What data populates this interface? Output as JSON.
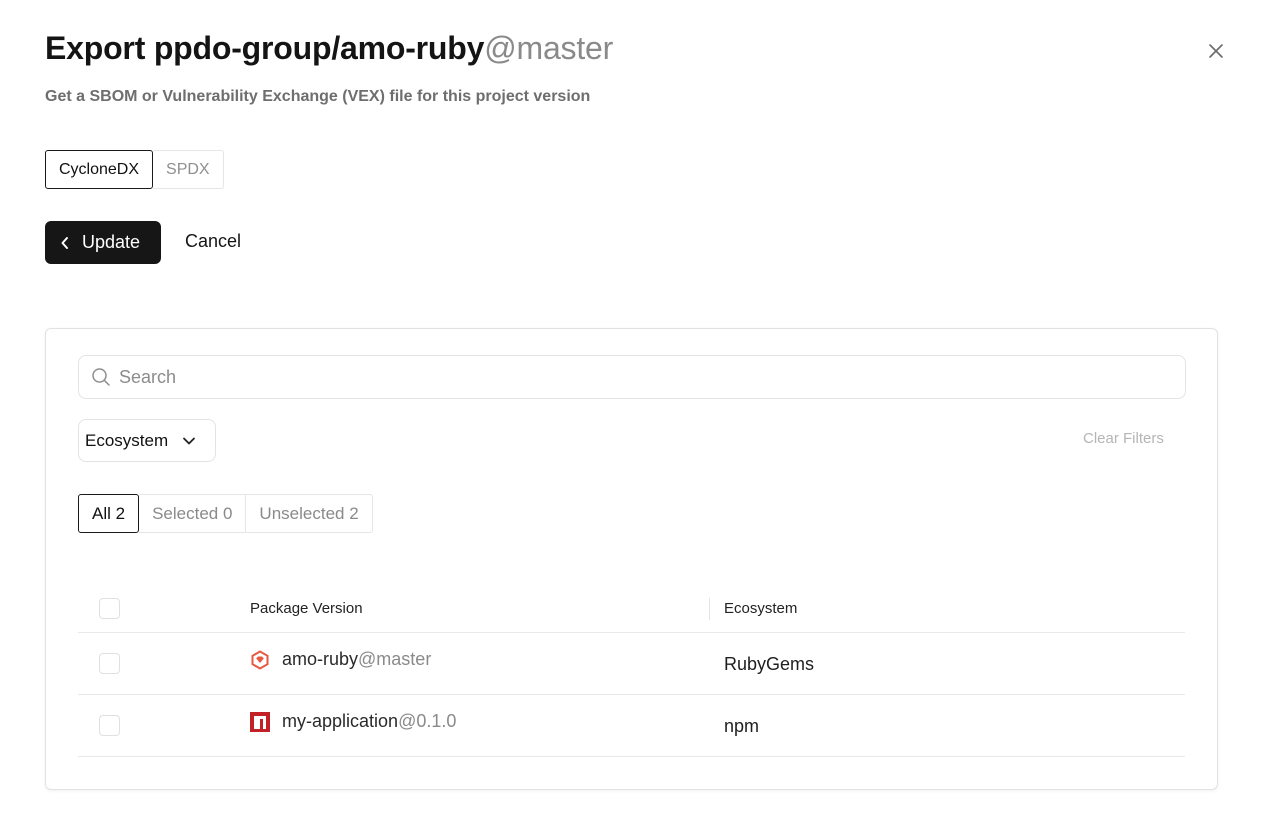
{
  "header": {
    "title_bold": "Export ppdo-group/amo-ruby",
    "title_muted": "@master",
    "subtitle": "Get a SBOM or Vulnerability Exchange (VEX) file for this project version"
  },
  "format": {
    "options": [
      "CycloneDX",
      "SPDX"
    ],
    "selected": "CycloneDX"
  },
  "actions": {
    "update_label": "Update",
    "cancel_label": "Cancel"
  },
  "filters": {
    "search_placeholder": "Search",
    "ecosystem_label": "Ecosystem",
    "clear_label": "Clear Filters"
  },
  "selection_tabs": [
    {
      "label": "All 2",
      "active": true
    },
    {
      "label": "Selected 0",
      "active": false
    },
    {
      "label": "Unselected 2",
      "active": false
    }
  ],
  "table": {
    "columns": [
      "Package Version",
      "Ecosystem"
    ],
    "rows": [
      {
        "name": "amo-ruby",
        "version": "@master",
        "ecosystem": "RubyGems",
        "icon": "rubygems-icon",
        "checked": false
      },
      {
        "name": "my-application",
        "version": "@0.1.0",
        "ecosystem": "npm",
        "icon": "npm-icon",
        "checked": false
      }
    ]
  },
  "colors": {
    "primary_button": "#161616",
    "rubygems_red": "#e9573f",
    "npm_red": "#c12127"
  }
}
